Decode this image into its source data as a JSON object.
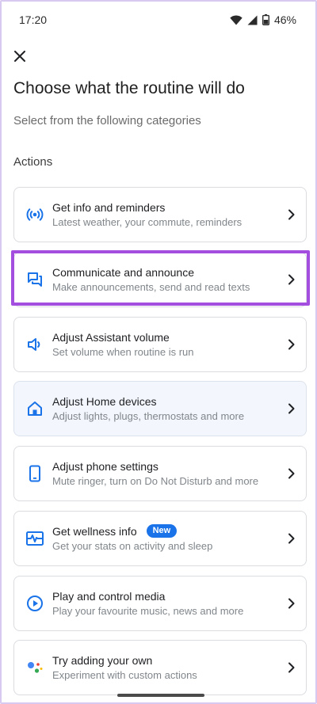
{
  "status_bar": {
    "time": "17:20",
    "battery": "46%"
  },
  "header": {
    "title": "Choose what the routine will do",
    "subtitle": "Select from the following categories"
  },
  "section_label": "Actions",
  "cards": [
    {
      "title": "Get info and reminders",
      "desc": "Latest weather, your commute, reminders",
      "icon": "broadcast-icon"
    },
    {
      "title": "Communicate and announce",
      "desc": "Make announcements, send and read texts",
      "icon": "chat-icon"
    },
    {
      "title": "Adjust Assistant volume",
      "desc": "Set volume when routine is run",
      "icon": "volume-icon"
    },
    {
      "title": "Adjust Home devices",
      "desc": "Adjust lights, plugs, thermostats and more",
      "icon": "home-icon"
    },
    {
      "title": "Adjust phone settings",
      "desc": "Mute ringer, turn on Do Not Disturb and more",
      "icon": "phone-icon"
    },
    {
      "title": "Get wellness info",
      "desc": "Get your stats on activity and sleep",
      "icon": "wellness-icon",
      "badge": "New"
    },
    {
      "title": "Play and control media",
      "desc": "Play your favourite music, news and more",
      "icon": "play-icon"
    },
    {
      "title": "Try adding your own",
      "desc": "Experiment with custom actions",
      "icon": "assistant-dots-icon"
    }
  ],
  "colors": {
    "accent": "#1a73e8",
    "highlight": "#a44ee0"
  }
}
